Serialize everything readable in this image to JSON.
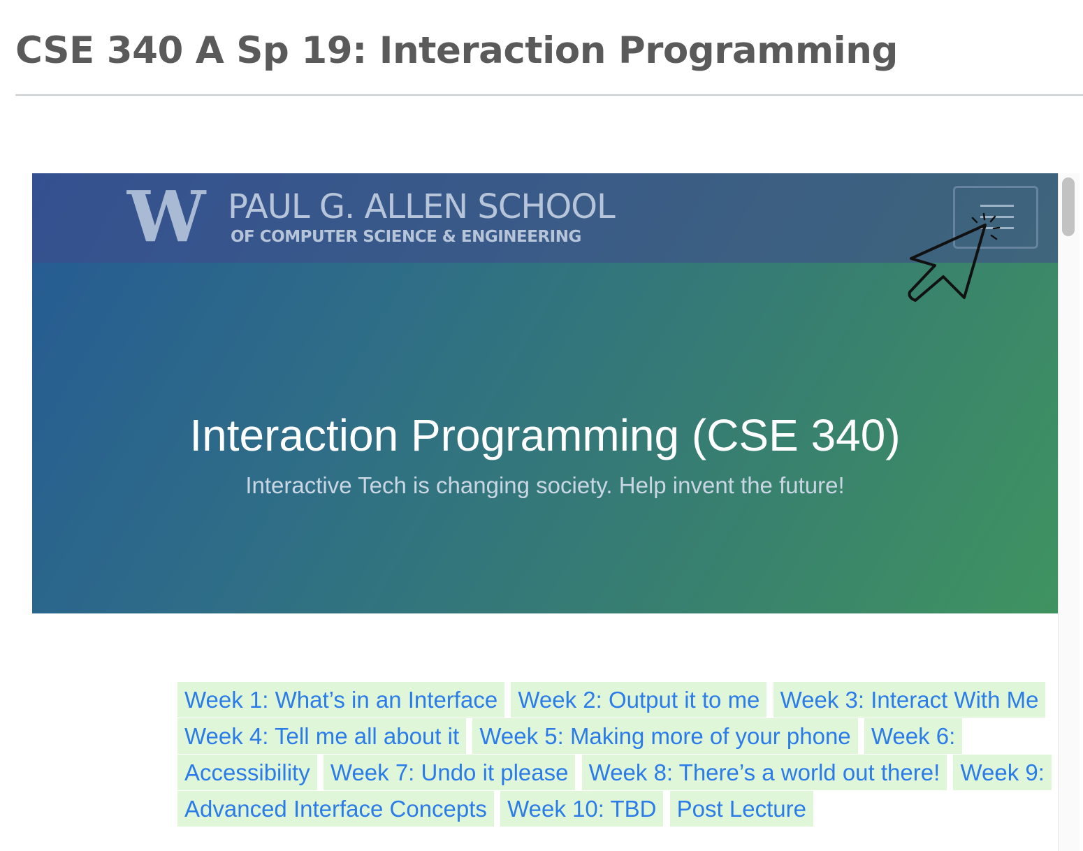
{
  "page": {
    "title": "CSE 340 A Sp 19: Interaction Programming"
  },
  "header": {
    "logo_letter": "W",
    "school_name": "PAUL G. ALLEN SCHOOL",
    "school_subtitle": "OF COMPUTER SCIENCE & ENGINEERING",
    "menu_icon": "hamburger-menu-icon",
    "cursor_icon": "click-cursor-icon"
  },
  "hero": {
    "title": "Interaction Programming (CSE 340)",
    "subtitle": "Interactive Tech is changing society. Help invent the future!"
  },
  "weeks": [
    "Week 1: What’s in an Interface",
    "Week 2: Output it to me",
    "Week 3: Interact With Me",
    "Week 4: Tell me all about it",
    "Week 5: Making more of your phone",
    "Week 6: Accessibility",
    "Week 7: Undo it please",
    "Week 8: There’s a world out there!",
    "Week 9: Advanced Interface Concepts",
    "Week 10: TBD",
    "Post Lecture"
  ],
  "colors": {
    "link": "#2b7be8",
    "link_background": "#dff7d8",
    "title_text": "#5a5a5a",
    "hero_gradient_start": "#255a94",
    "hero_gradient_end": "#3f9360"
  }
}
